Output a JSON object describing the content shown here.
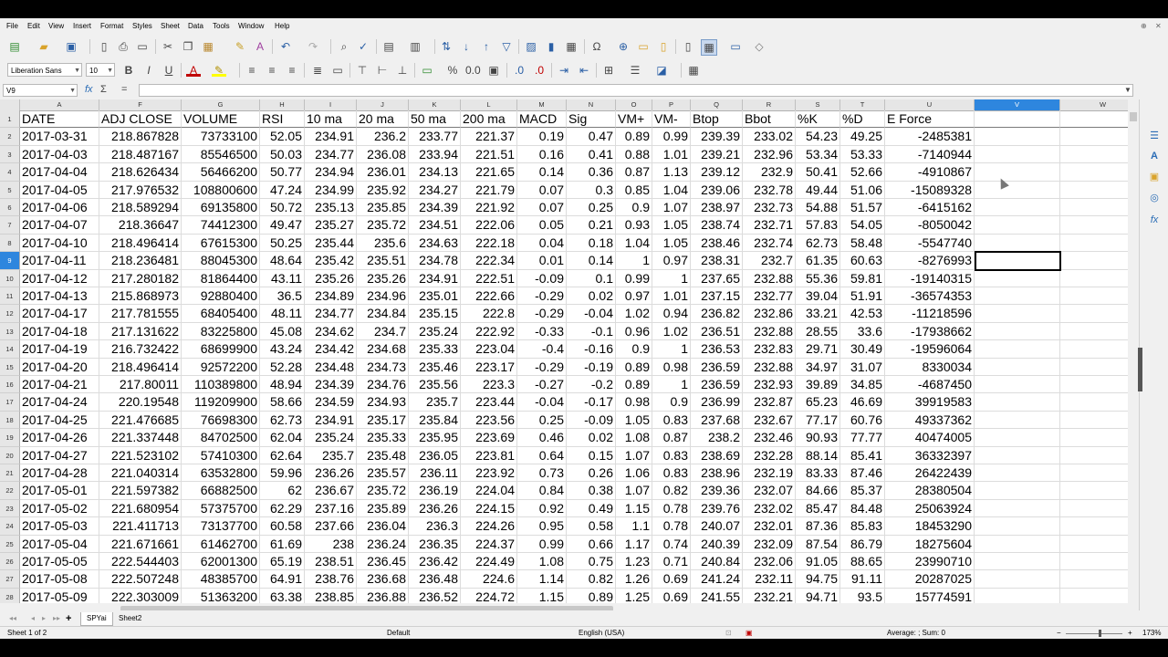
{
  "menu": [
    "File",
    "Edit",
    "View",
    "Insert",
    "Format",
    "Styles",
    "Sheet",
    "Data",
    "Tools",
    "Window",
    "Help"
  ],
  "toolbar": {
    "font_name": "Liberation Sans",
    "font_size": "10"
  },
  "formula_bar": {
    "cell_ref": "V9",
    "content": ""
  },
  "columns": [
    "A",
    "F",
    "G",
    "H",
    "I",
    "J",
    "K",
    "L",
    "M",
    "N",
    "O",
    "P",
    "Q",
    "R",
    "S",
    "T",
    "U",
    "V",
    "W"
  ],
  "selected_column": "V",
  "header_row": [
    "DATE",
    "ADJ CLOSE",
    "VOLUME",
    "RSI",
    "10 ma",
    "20 ma",
    "50 ma",
    "200 ma",
    "MACD",
    "Sig",
    "VM+",
    "VM-",
    "Btop",
    "Bbot",
    "%K",
    "%D",
    "E Force"
  ],
  "row_numbers": [
    "1",
    "2",
    "3",
    "4",
    "5",
    "6",
    "7",
    "8",
    "9",
    "10",
    "11",
    "12",
    "13",
    "14",
    "15",
    "16",
    "17",
    "18",
    "19",
    "20",
    "21",
    "22",
    "23",
    "24",
    "25",
    "26",
    "27",
    "28"
  ],
  "selected_row": "9",
  "rows": [
    [
      "2017-03-31",
      "218.867828",
      "73733100",
      "52.05",
      "234.91",
      "236.2",
      "233.77",
      "221.37",
      "0.19",
      "0.47",
      "0.89",
      "0.99",
      "239.39",
      "233.02",
      "54.23",
      "49.25",
      "-2485381"
    ],
    [
      "2017-04-03",
      "218.487167",
      "85546500",
      "50.03",
      "234.77",
      "236.08",
      "233.94",
      "221.51",
      "0.16",
      "0.41",
      "0.88",
      "1.01",
      "239.21",
      "232.96",
      "53.34",
      "53.33",
      "-7140944"
    ],
    [
      "2017-04-04",
      "218.626434",
      "56466200",
      "50.77",
      "234.94",
      "236.01",
      "234.13",
      "221.65",
      "0.14",
      "0.36",
      "0.87",
      "1.13",
      "239.12",
      "232.9",
      "50.41",
      "52.66",
      "-4910867"
    ],
    [
      "2017-04-05",
      "217.976532",
      "108800600",
      "47.24",
      "234.99",
      "235.92",
      "234.27",
      "221.79",
      "0.07",
      "0.3",
      "0.85",
      "1.04",
      "239.06",
      "232.78",
      "49.44",
      "51.06",
      "-15089328"
    ],
    [
      "2017-04-06",
      "218.589294",
      "69135800",
      "50.72",
      "235.13",
      "235.85",
      "234.39",
      "221.92",
      "0.07",
      "0.25",
      "0.9",
      "1.07",
      "238.97",
      "232.73",
      "54.88",
      "51.57",
      "-6415162"
    ],
    [
      "2017-04-07",
      "218.36647",
      "74412300",
      "49.47",
      "235.27",
      "235.72",
      "234.51",
      "222.06",
      "0.05",
      "0.21",
      "0.93",
      "1.05",
      "238.74",
      "232.71",
      "57.83",
      "54.05",
      "-8050042"
    ],
    [
      "2017-04-10",
      "218.496414",
      "67615300",
      "50.25",
      "235.44",
      "235.6",
      "234.63",
      "222.18",
      "0.04",
      "0.18",
      "1.04",
      "1.05",
      "238.46",
      "232.74",
      "62.73",
      "58.48",
      "-5547740"
    ],
    [
      "2017-04-11",
      "218.236481",
      "88045300",
      "48.64",
      "235.42",
      "235.51",
      "234.78",
      "222.34",
      "0.01",
      "0.14",
      "1",
      "0.97",
      "238.31",
      "232.7",
      "61.35",
      "60.63",
      "-8276993"
    ],
    [
      "2017-04-12",
      "217.280182",
      "81864400",
      "43.11",
      "235.26",
      "235.26",
      "234.91",
      "222.51",
      "-0.09",
      "0.1",
      "0.99",
      "1",
      "237.65",
      "232.88",
      "55.36",
      "59.81",
      "-19140315"
    ],
    [
      "2017-04-13",
      "215.868973",
      "92880400",
      "36.5",
      "234.89",
      "234.96",
      "235.01",
      "222.66",
      "-0.29",
      "0.02",
      "0.97",
      "1.01",
      "237.15",
      "232.77",
      "39.04",
      "51.91",
      "-36574353"
    ],
    [
      "2017-04-17",
      "217.781555",
      "68405400",
      "48.11",
      "234.77",
      "234.84",
      "235.15",
      "222.8",
      "-0.29",
      "-0.04",
      "1.02",
      "0.94",
      "236.82",
      "232.86",
      "33.21",
      "42.53",
      "-11218596"
    ],
    [
      "2017-04-18",
      "217.131622",
      "83225800",
      "45.08",
      "234.62",
      "234.7",
      "235.24",
      "222.92",
      "-0.33",
      "-0.1",
      "0.96",
      "1.02",
      "236.51",
      "232.88",
      "28.55",
      "33.6",
      "-17938662"
    ],
    [
      "2017-04-19",
      "216.732422",
      "68699900",
      "43.24",
      "234.42",
      "234.68",
      "235.33",
      "223.04",
      "-0.4",
      "-0.16",
      "0.9",
      "1",
      "236.53",
      "232.83",
      "29.71",
      "30.49",
      "-19596064"
    ],
    [
      "2017-04-20",
      "218.496414",
      "92572200",
      "52.28",
      "234.48",
      "234.73",
      "235.46",
      "223.17",
      "-0.29",
      "-0.19",
      "0.89",
      "0.98",
      "236.59",
      "232.88",
      "34.97",
      "31.07",
      "8330034"
    ],
    [
      "2017-04-21",
      "217.80011",
      "110389800",
      "48.94",
      "234.39",
      "234.76",
      "235.56",
      "223.3",
      "-0.27",
      "-0.2",
      "0.89",
      "1",
      "236.59",
      "232.93",
      "39.89",
      "34.85",
      "-4687450"
    ],
    [
      "2017-04-24",
      "220.19548",
      "119209900",
      "58.66",
      "234.59",
      "234.93",
      "235.7",
      "223.44",
      "-0.04",
      "-0.17",
      "0.98",
      "0.9",
      "236.99",
      "232.87",
      "65.23",
      "46.69",
      "39919583"
    ],
    [
      "2017-04-25",
      "221.476685",
      "76698300",
      "62.73",
      "234.91",
      "235.17",
      "235.84",
      "223.56",
      "0.25",
      "-0.09",
      "1.05",
      "0.83",
      "237.68",
      "232.67",
      "77.17",
      "60.76",
      "49337362"
    ],
    [
      "2017-04-26",
      "221.337448",
      "84702500",
      "62.04",
      "235.24",
      "235.33",
      "235.95",
      "223.69",
      "0.46",
      "0.02",
      "1.08",
      "0.87",
      "238.2",
      "232.46",
      "90.93",
      "77.77",
      "40474005"
    ],
    [
      "2017-04-27",
      "221.523102",
      "57410300",
      "62.64",
      "235.7",
      "235.48",
      "236.05",
      "223.81",
      "0.64",
      "0.15",
      "1.07",
      "0.83",
      "238.69",
      "232.28",
      "88.14",
      "85.41",
      "36332397"
    ],
    [
      "2017-04-28",
      "221.040314",
      "63532800",
      "59.96",
      "236.26",
      "235.57",
      "236.11",
      "223.92",
      "0.73",
      "0.26",
      "1.06",
      "0.83",
      "238.96",
      "232.19",
      "83.33",
      "87.46",
      "26422439"
    ],
    [
      "2017-05-01",
      "221.597382",
      "66882500",
      "62",
      "236.67",
      "235.72",
      "236.19",
      "224.04",
      "0.84",
      "0.38",
      "1.07",
      "0.82",
      "239.36",
      "232.07",
      "84.66",
      "85.37",
      "28380504"
    ],
    [
      "2017-05-02",
      "221.680954",
      "57375700",
      "62.29",
      "237.16",
      "235.89",
      "236.26",
      "224.15",
      "0.92",
      "0.49",
      "1.15",
      "0.78",
      "239.76",
      "232.02",
      "85.47",
      "84.48",
      "25063924"
    ],
    [
      "2017-05-03",
      "221.411713",
      "73137700",
      "60.58",
      "237.66",
      "236.04",
      "236.3",
      "224.26",
      "0.95",
      "0.58",
      "1.1",
      "0.78",
      "240.07",
      "232.01",
      "87.36",
      "85.83",
      "18453290"
    ],
    [
      "2017-05-04",
      "221.671661",
      "61462700",
      "61.69",
      "238",
      "236.24",
      "236.35",
      "224.37",
      "0.99",
      "0.66",
      "1.17",
      "0.74",
      "240.39",
      "232.09",
      "87.54",
      "86.79",
      "18275604"
    ],
    [
      "2017-05-05",
      "222.544403",
      "62001300",
      "65.19",
      "238.51",
      "236.45",
      "236.42",
      "224.49",
      "1.08",
      "0.75",
      "1.23",
      "0.71",
      "240.84",
      "232.06",
      "91.05",
      "88.65",
      "23990710"
    ],
    [
      "2017-05-08",
      "222.507248",
      "48385700",
      "64.91",
      "238.76",
      "236.68",
      "236.48",
      "224.6",
      "1.14",
      "0.82",
      "1.26",
      "0.69",
      "241.24",
      "232.11",
      "94.75",
      "91.11",
      "20287025"
    ],
    [
      "2017-05-09",
      "222.303009",
      "51363200",
      "63.38",
      "238.85",
      "236.88",
      "236.52",
      "224.72",
      "1.15",
      "0.89",
      "1.25",
      "0.69",
      "241.55",
      "232.21",
      "94.71",
      "93.5",
      "15774591"
    ]
  ],
  "sheet_tabs": [
    "SPYai",
    "Sheet2"
  ],
  "active_tab": "SPYai",
  "status": {
    "sheet": "Sheet 1 of 2",
    "page_style": "Default",
    "language": "English (USA)",
    "summary": "Average: ; Sum: 0",
    "zoom": "173%"
  }
}
